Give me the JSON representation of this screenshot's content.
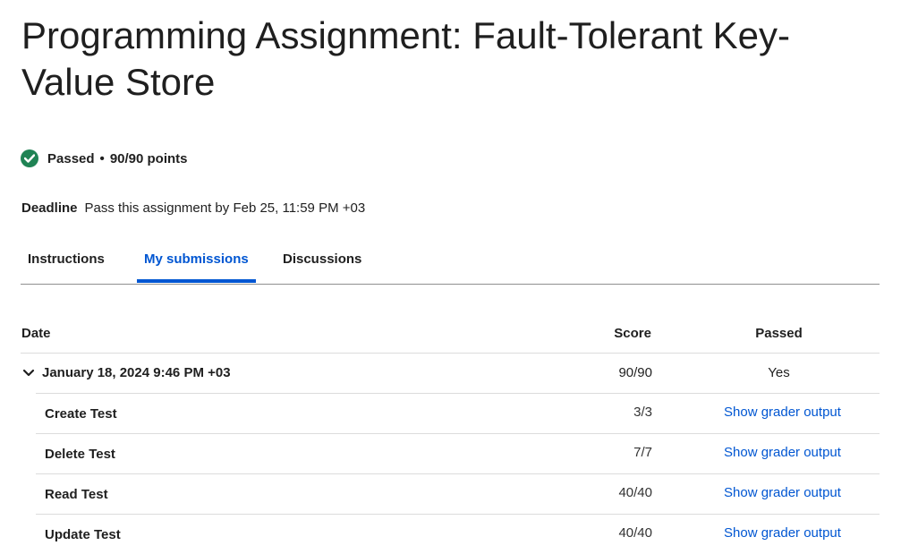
{
  "title": "Programming Assignment: Fault-Tolerant Key-Value Store",
  "status": {
    "label": "Passed",
    "separator": "•",
    "points": "90/90 points",
    "color": "#1f8354"
  },
  "deadline": {
    "label": "Deadline",
    "text": "Pass this assignment by Feb 25, 11:59 PM +03"
  },
  "tabs": [
    {
      "label": "Instructions"
    },
    {
      "label": "My submissions"
    },
    {
      "label": "Discussions"
    }
  ],
  "accent_color": "#0056d2",
  "table": {
    "headers": {
      "date": "Date",
      "score": "Score",
      "passed": "Passed"
    },
    "submission": {
      "date": "January 18, 2024 9:46 PM +03",
      "score": "90/90",
      "passed": "Yes",
      "icon": "chevron-down-icon"
    },
    "tests": [
      {
        "name": "Create Test",
        "score": "3/3",
        "link": "Show grader output"
      },
      {
        "name": "Delete Test",
        "score": "7/7",
        "link": "Show grader output"
      },
      {
        "name": "Read Test",
        "score": "40/40",
        "link": "Show grader output"
      },
      {
        "name": "Update Test",
        "score": "40/40",
        "link": "Show grader output"
      }
    ]
  }
}
